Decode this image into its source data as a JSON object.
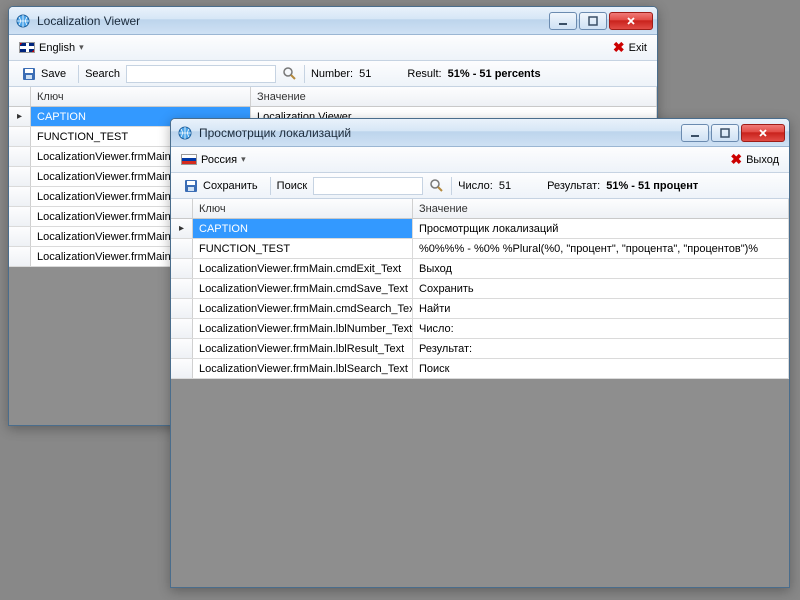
{
  "window1": {
    "title": "Localization Viewer",
    "lang_label": "English",
    "exit_label": "Exit",
    "save_label": "Save",
    "search_label": "Search",
    "number_label": "Number:",
    "number_value": "51",
    "result_label": "Result:",
    "result_value": "51% - 51 percents",
    "col_key": "Ключ",
    "col_val": "Значение",
    "rows": [
      {
        "key": "CAPTION",
        "val": "Localization Viewer",
        "selected": true
      },
      {
        "key": "FUNCTION_TEST",
        "val": ""
      },
      {
        "key": "LocalizationViewer.frmMain.cmdExit_Text",
        "val": ""
      },
      {
        "key": "LocalizationViewer.frmMain.cmdSave_Text",
        "val": ""
      },
      {
        "key": "LocalizationViewer.frmMain.cmdSearch_Text",
        "val": ""
      },
      {
        "key": "LocalizationViewer.frmMain.lblNumber_Text",
        "val": ""
      },
      {
        "key": "LocalizationViewer.frmMain.lblResult_Text",
        "val": ""
      },
      {
        "key": "LocalizationViewer.frmMain.lblSearch_Text",
        "val": ""
      }
    ]
  },
  "window2": {
    "title": "Просмотрщик локализаций",
    "lang_label": "Россия",
    "exit_label": "Выход",
    "save_label": "Сохранить",
    "search_label": "Поиск",
    "number_label": "Число:",
    "number_value": "51",
    "result_label": "Результат:",
    "result_value": "51% - 51 процент",
    "col_key": "Ключ",
    "col_val": "Значение",
    "rows": [
      {
        "key": "CAPTION",
        "val": "Просмотрщик локализаций",
        "selected": true
      },
      {
        "key": "FUNCTION_TEST",
        "val": "%0%%% - %0% %Plural(%0, \"процент\", \"процента\", \"процентов\")%"
      },
      {
        "key": "LocalizationViewer.frmMain.cmdExit_Text",
        "val": "Выход"
      },
      {
        "key": "LocalizationViewer.frmMain.cmdSave_Text",
        "val": "Сохранить"
      },
      {
        "key": "LocalizationViewer.frmMain.cmdSearch_Text",
        "val": "Найти"
      },
      {
        "key": "LocalizationViewer.frmMain.lblNumber_Text",
        "val": "Число:"
      },
      {
        "key": "LocalizationViewer.frmMain.lblResult_Text",
        "val": "Результат:"
      },
      {
        "key": "LocalizationViewer.frmMain.lblSearch_Text",
        "val": "Поиск"
      }
    ]
  }
}
